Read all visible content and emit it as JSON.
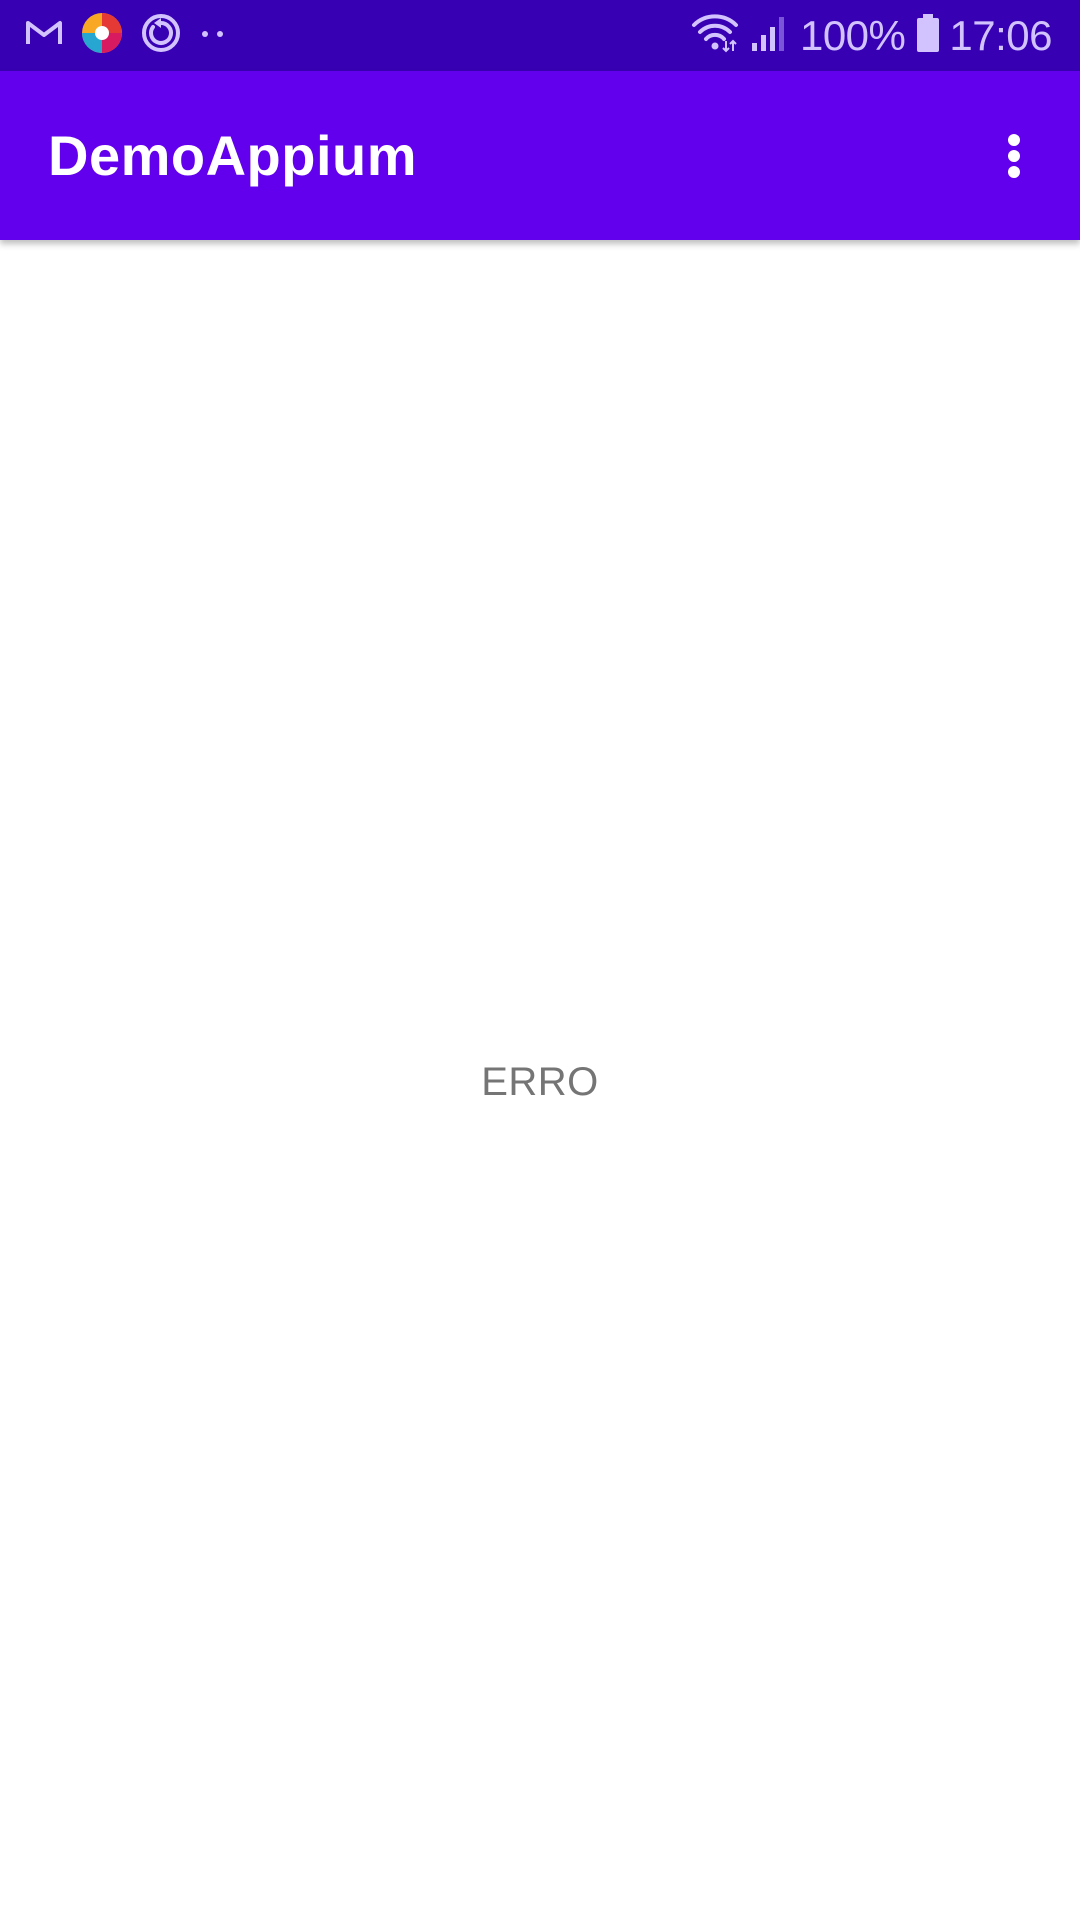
{
  "status_bar": {
    "left_icons": [
      "gmail-icon",
      "photos-icon",
      "sync-icon",
      "more-notifications-icon"
    ],
    "right_icons": [
      "wifi-icon",
      "signal-icon",
      "battery-icon"
    ],
    "battery_percent": "100%",
    "time": "17:06",
    "background_color": "#3700b3",
    "icon_color": "#d2c3ff"
  },
  "app_bar": {
    "title": "DemoAppium",
    "overflow_icon": "more-vert-icon",
    "background_color": "#6200ee"
  },
  "main": {
    "message": "ERRO"
  }
}
